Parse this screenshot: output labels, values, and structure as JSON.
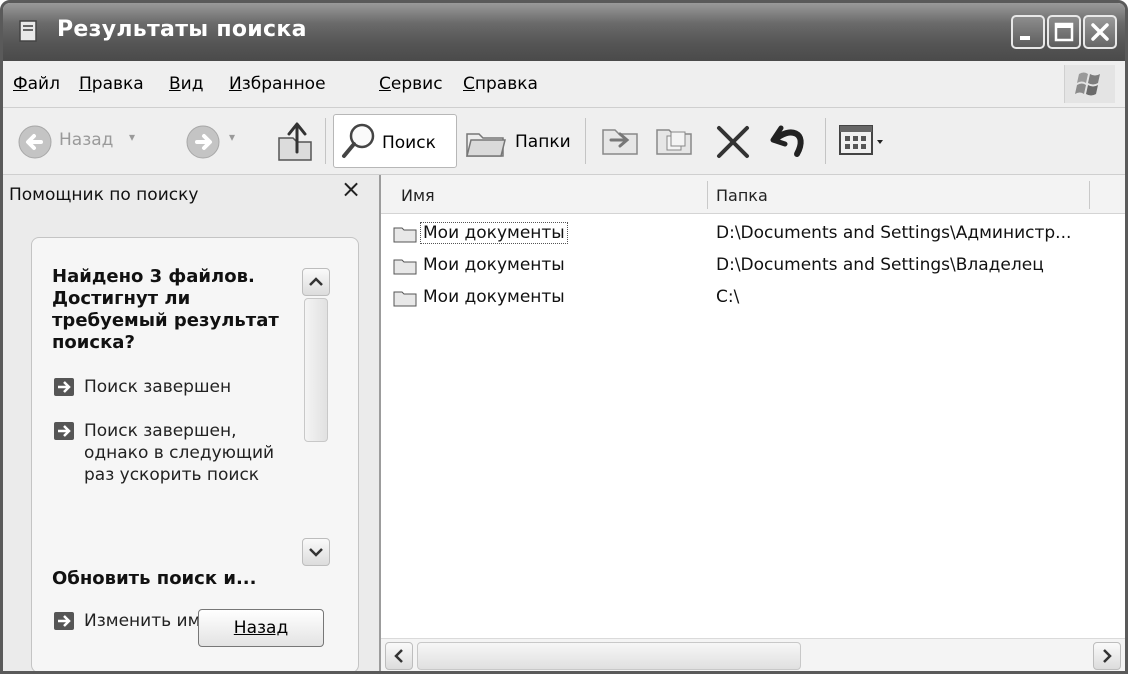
{
  "window": {
    "title": "Результаты поиска"
  },
  "menu": {
    "items": [
      {
        "first": "Ф",
        "rest": "айл"
      },
      {
        "first": "П",
        "rest": "равка"
      },
      {
        "first": "В",
        "rest": "ид"
      },
      {
        "first": "И",
        "rest": "збранное"
      },
      {
        "first": "С",
        "rest": "ервис"
      },
      {
        "first": "С",
        "rest": "правка"
      }
    ]
  },
  "toolbar": {
    "back_label": "Назад",
    "search_label": "Поиск",
    "folders_label": "Папки"
  },
  "assistant": {
    "title": "Помощник по поиску",
    "close_glyph": "×",
    "question": "Найдено 3 файлов. Достигнут ли требуемый результат поиска?",
    "options": [
      "Поиск завершен",
      "Поиск завершен, однако в следующий раз ускорить поиск"
    ],
    "refine_heading": "Обновить поиск и...",
    "refine_options": [
      "Изменить имя файла"
    ],
    "back_button": "Назад"
  },
  "results": {
    "columns": [
      "Имя",
      "Папка"
    ],
    "rows": [
      {
        "name": "Мои документы",
        "folder": "D:\\Documents and Settings\\Администр..."
      },
      {
        "name": "Мои документы",
        "folder": "D:\\Documents and Settings\\Владелец"
      },
      {
        "name": "Мои документы",
        "folder": "C:\\"
      }
    ]
  },
  "icons": [
    "window-icon",
    "minimize-icon",
    "maximize-icon",
    "close-icon",
    "back-arrow-icon",
    "forward-arrow-icon",
    "up-folder-icon",
    "search-magnifier-icon",
    "folders-icon",
    "move-to-icon",
    "copy-to-icon",
    "delete-x-icon",
    "undo-icon",
    "views-icon",
    "folder-icon",
    "arrow-right-icon",
    "windows-logo-icon"
  ]
}
